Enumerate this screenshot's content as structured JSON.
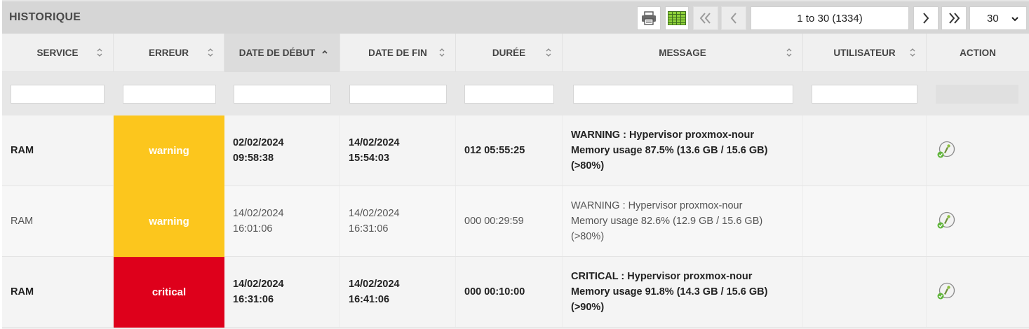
{
  "header": {
    "title": "HISTORIQUE",
    "print_icon": "printer-icon",
    "columns_icon": "grid-columns-icon",
    "page_range": "1 to 30 (1334)",
    "page_size": "30"
  },
  "columns": [
    {
      "label": "SERVICE"
    },
    {
      "label": "ERREUR"
    },
    {
      "label": "DATE DE DÉBUT"
    },
    {
      "label": "DATE DE FIN"
    },
    {
      "label": "DURÉE"
    },
    {
      "label": "MESSAGE"
    },
    {
      "label": "UTILISATEUR"
    },
    {
      "label": "ACTION"
    }
  ],
  "rows": [
    {
      "service": "RAM",
      "error": "warning",
      "start_date": "02/02/2024",
      "start_time": "09:58:38",
      "end_date": "14/02/2024",
      "end_time": "15:54:03",
      "duration": "012 05:55:25",
      "msg1": "WARNING : Hypervisor proxmox-nour",
      "msg2": "Memory usage 87.5% (13.6 GB / 15.6 GB)",
      "msg3": "(>80%)",
      "user": ""
    },
    {
      "service": "RAM",
      "error": "warning",
      "start_date": "14/02/2024",
      "start_time": "16:01:06",
      "end_date": "14/02/2024",
      "end_time": "16:31:06",
      "duration": "000 00:29:59",
      "msg1": "WARNING : Hypervisor proxmox-nour",
      "msg2": "Memory usage 82.6% (12.9 GB / 15.6 GB)",
      "msg3": "(>80%)",
      "user": ""
    },
    {
      "service": "RAM",
      "error": "critical",
      "start_date": "14/02/2024",
      "start_time": "16:31:06",
      "end_date": "14/02/2024",
      "end_time": "16:41:06",
      "duration": "000 00:10:00",
      "msg1": "CRITICAL : Hypervisor proxmox-nour",
      "msg2": "Memory usage 91.8% (14.3 GB / 15.6 GB)",
      "msg3": "(>90%)",
      "user": ""
    }
  ],
  "colors": {
    "warning": "#fcc61d",
    "critical": "#de001b"
  }
}
